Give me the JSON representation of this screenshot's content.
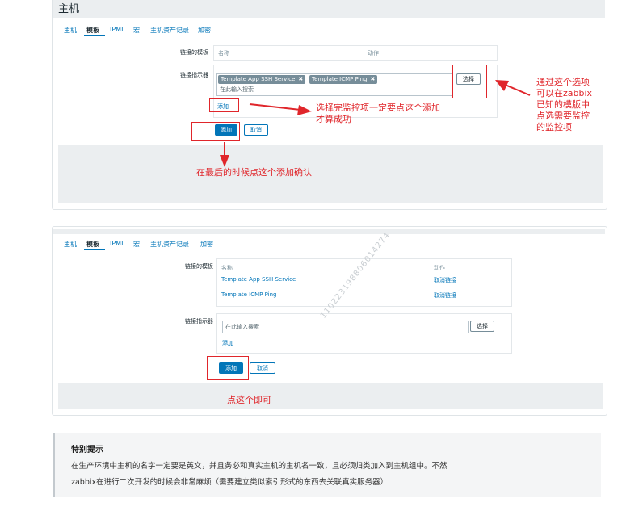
{
  "page_title": "主机",
  "tabs": [
    "主机",
    "模板",
    "IPMI",
    "宏",
    "主机资产记录",
    "加密"
  ],
  "panel1": {
    "linked_templates_label": "链接的模板",
    "col_name": "名称",
    "col_action": "动作",
    "link_indicator_label": "链接指示器",
    "selected_tags": [
      "Template App SSH Service",
      "Template ICMP Ping"
    ],
    "tag_remove": "✖",
    "search_placeholder": "在此输入搜索",
    "select_button": "选择",
    "add_link": "添加",
    "add_button": "添加",
    "cancel_button": "取消"
  },
  "annotations": {
    "select_note": [
      "通过这个选项",
      "可以在zabbix",
      "已知的模版中",
      "点选需要监控",
      "的监控项"
    ],
    "add_note": [
      "选择完监控项一定要点这个添加",
      "才算成功"
    ],
    "confirm_note": "在最后的时候点这个添加确认",
    "final_note": "点这个即可"
  },
  "panel2": {
    "linked_templates_label": "链接的模板",
    "col_name": "名称",
    "col_action": "动作",
    "templates": [
      {
        "name": "Template App SSH Service",
        "action": "取消链接"
      },
      {
        "name": "Template ICMP Ping",
        "action": "取消链接"
      }
    ],
    "link_indicator_label": "链接指示器",
    "search_placeholder": "在此输入搜索",
    "select_button": "选择",
    "add_link": "添加",
    "add_button": "添加",
    "cancel_button": "取消",
    "watermark": "110223198806014274"
  },
  "tip": {
    "title": "特别提示",
    "lines": [
      "在生产环境中主机的名字一定要是英文，并且务必和真实主机的主机名一致，且必须归类加入到主机组中。不然",
      "zabbix在进行二次开发的时候会非常麻烦（需要建立类似索引形式的东西去关联真实服务器）"
    ]
  },
  "colors": {
    "accent": "#0275b8",
    "annotation": "#e0262b",
    "footer": "#ebeef0"
  }
}
